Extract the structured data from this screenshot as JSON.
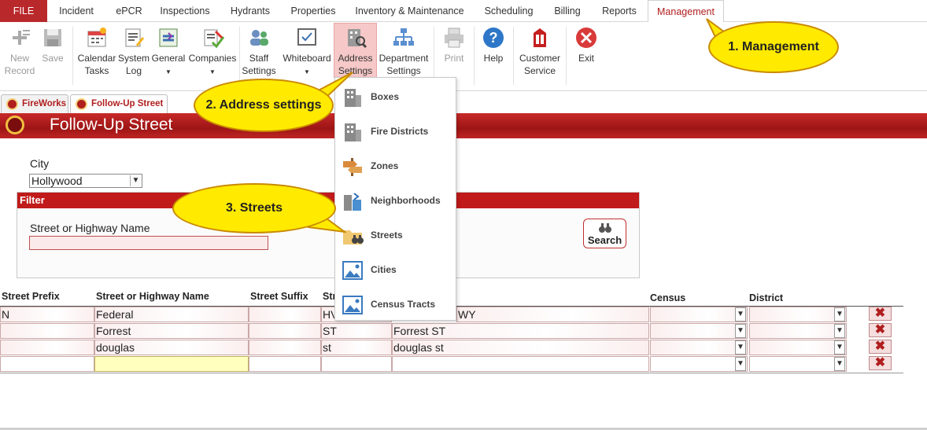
{
  "ribbon_tabs": [
    "FILE",
    "Incident",
    "ePCR",
    "Inspections",
    "Hydrants",
    "Properties",
    "Inventory & Maintenance",
    "Scheduling",
    "Billing",
    "Reports",
    "Management"
  ],
  "ribbon": {
    "new_record": "New Record",
    "save": "Save",
    "calendar_tasks": "Calendar Tasks",
    "system_log": "System Log",
    "general": "General",
    "companies": "Companies",
    "staff_settings": "Staff Settings",
    "whiteboard": "Whiteboard",
    "address_settings": "Address Settings",
    "department_settings": "Department Settings",
    "print": "Print",
    "help": "Help",
    "customer_service": "Customer Service",
    "exit": "Exit"
  },
  "doc_tabs": [
    "FireWorks",
    "Follow-Up Street"
  ],
  "header_title": "Follow-Up Street",
  "city_label": "City",
  "city_value": "Hollywood",
  "filter_title": "Filter",
  "street_name_label": "Street or Highway Name",
  "search_label": "Search",
  "columns": [
    "Street Prefix",
    "Street or Highway Name",
    "Street Suffix",
    "Str",
    "Census",
    "District"
  ],
  "rows": [
    {
      "prefix": "N",
      "name": "Federal",
      "suffix": "",
      "type": "HV",
      "full": "WY"
    },
    {
      "prefix": "",
      "name": "Forrest",
      "suffix": "",
      "type": "ST",
      "full": "Forrest ST"
    },
    {
      "prefix": "",
      "name": "douglas",
      "suffix": "",
      "type": "st",
      "full": "douglas st"
    }
  ],
  "address_menu": [
    "Boxes",
    "Fire Districts",
    "Zones",
    "Neighborhoods",
    "Streets",
    "Cities",
    "Census Tracts"
  ],
  "callouts": {
    "step1": "1. Management",
    "step2": "2. Address settings",
    "step3": "3. Streets"
  },
  "colors": {
    "brand_red": "#b9282b",
    "callout_yellow": "#ffea00"
  }
}
